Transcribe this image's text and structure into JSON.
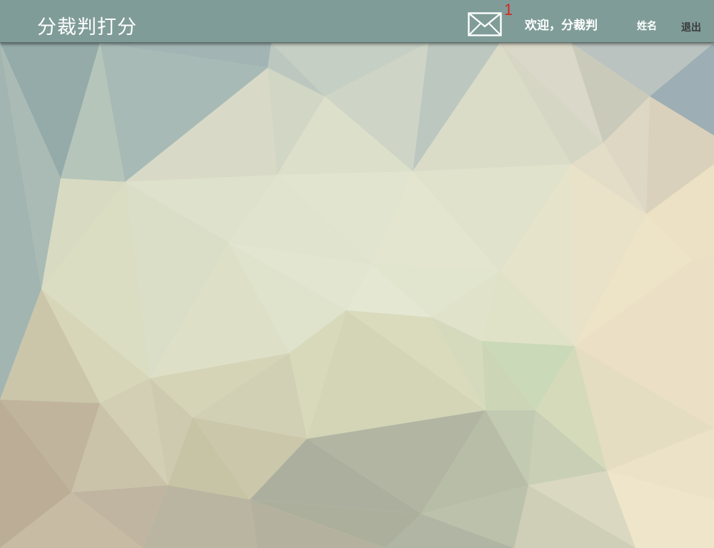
{
  "header": {
    "app_title": "分裁判打分",
    "mail_count": "1",
    "welcome_text": "欢迎，分裁判",
    "user_name": "姓名",
    "logout_label": "退出"
  },
  "icons": {
    "mail": "envelope-icon"
  },
  "colors": {
    "header_bg": "#7f9c98",
    "badge": "#d8261e",
    "header_text": "#ffffff",
    "logout_text": "#3a3a3a"
  }
}
